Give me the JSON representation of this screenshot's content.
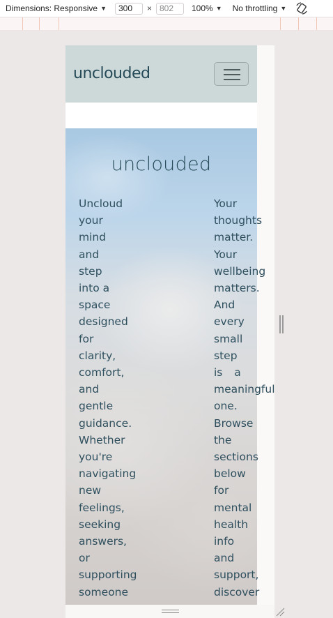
{
  "devtools": {
    "dimensions_label": "Dimensions: Responsive",
    "width_value": "300",
    "height_value": "802",
    "times": "×",
    "zoom": "100%",
    "throttling": "No throttling",
    "icons": [
      "chevron-down-icon",
      "rotate-icon"
    ]
  },
  "navbar": {
    "brand": "unclouded",
    "toggler_icon": "hamburger-icon",
    "background": "#cdd9d9",
    "brand_color": "#264a57"
  },
  "hero": {
    "title": "unclouded",
    "left_column": [
      "Uncloud",
      "your",
      "mind",
      "and",
      "step",
      "into a",
      "space",
      "designed",
      "for",
      "clarity,",
      "comfort,",
      "and",
      "gentle",
      "guidance.",
      "Whether",
      "you're",
      "navigating",
      "new",
      "feelings,",
      "seeking",
      "answers,",
      "or",
      "supporting",
      "someone"
    ],
    "right_column": [
      "Your",
      "thoughts",
      "matter.",
      "Your",
      "wellbeing",
      "matters.",
      "And",
      "every",
      "small",
      "step",
      "is a",
      "meaningful",
      "one.",
      "Browse",
      "the",
      "sections",
      "below",
      "for",
      "mental",
      "health",
      "info",
      "and",
      "support,",
      "discover"
    ],
    "text_color": "#2e4f5e"
  }
}
